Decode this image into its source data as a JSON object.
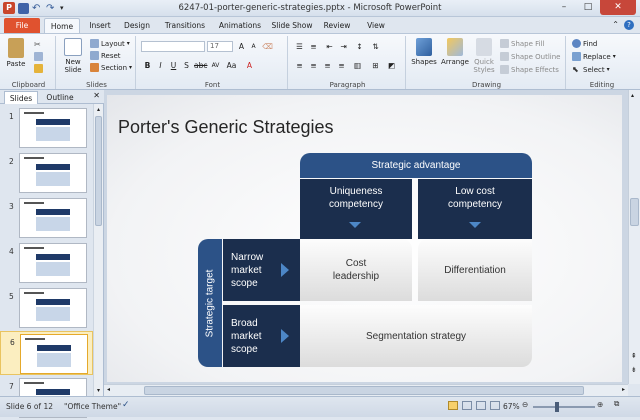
{
  "window": {
    "title": "6247-01-porter-generic-strategies.pptx - Microsoft PowerPoint"
  },
  "tabs": [
    "File",
    "Home",
    "Insert",
    "Design",
    "Transitions",
    "Animations",
    "Slide Show",
    "Review",
    "View"
  ],
  "ribbon": {
    "clipboard": {
      "paste": "Paste",
      "group": "Clipboard"
    },
    "slides": {
      "new_slide": "New Slide",
      "layout": "Layout",
      "reset": "Reset",
      "section": "Section",
      "group": "Slides"
    },
    "font": {
      "font_size": "17",
      "group": "Font"
    },
    "paragraph": {
      "group": "Paragraph"
    },
    "drawing": {
      "shapes": "Shapes",
      "arrange": "Arrange",
      "quick_styles": "Quick Styles",
      "shape_fill": "Shape Fill",
      "shape_outline": "Shape Outline",
      "shape_effects": "Shape Effects",
      "group": "Drawing"
    },
    "editing": {
      "find": "Find",
      "replace": "Replace",
      "select": "Select",
      "group": "Editing"
    }
  },
  "pane": {
    "tab_slides": "Slides",
    "tab_outline": "Outline",
    "thumbnails": [
      "1",
      "2",
      "3",
      "4",
      "5",
      "6",
      "7"
    ],
    "selected": "6"
  },
  "slide": {
    "title": "Porter's Generic Strategies",
    "strategic_advantage": "Strategic advantage",
    "uniqueness": "Uniqueness competency",
    "low_cost": "Low cost competency",
    "strategic_target": "Strategic target",
    "narrow": "Narrow market scope",
    "broad": "Broad market scope",
    "cost_leadership": "Cost leadership",
    "differentiation": "Differentiation",
    "segmentation": "Segmentation strategy"
  },
  "status": {
    "slide_info": "Slide 6 of 12",
    "theme": "\"Office Theme\"",
    "zoom": "67%"
  },
  "colors": {
    "dark_navy": "#1b2e4d",
    "header_blue": "#2c5287",
    "arrow_blue": "#4d87c7",
    "file_tab": "#e0522f"
  }
}
